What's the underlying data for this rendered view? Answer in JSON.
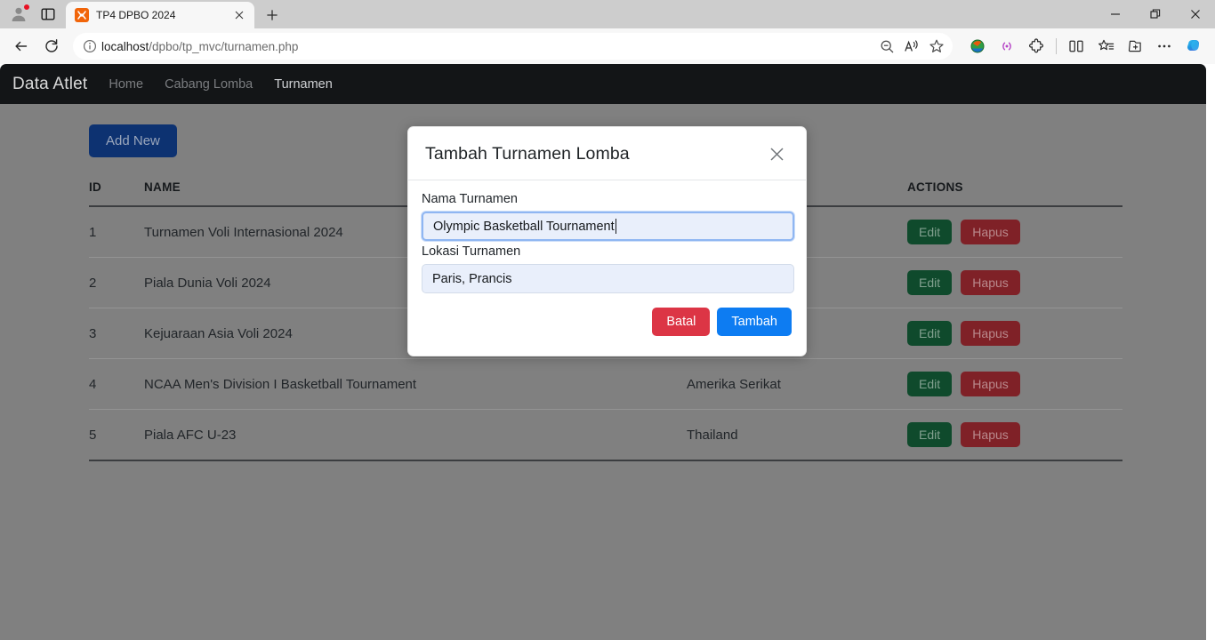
{
  "browser": {
    "tab": {
      "title": "TP4 DPBO 2024",
      "favicon": "xampp-icon",
      "close": "×"
    },
    "newtab_label": "+",
    "url": {
      "host": "localhost",
      "path": "/dpbo/tp_mvc/turnamen.php"
    },
    "window_controls": {
      "minimize": "—",
      "restore": "❐",
      "close": "✕"
    },
    "toolbar_icons": [
      "back-icon",
      "reload-icon",
      "info-icon",
      "zoom-out-icon",
      "read-aloud-icon",
      "favorite-star-icon",
      "idm-extension-icon",
      "cast-icon",
      "extensions-icon",
      "split-screen-icon",
      "collections-favorites-icon",
      "add-to-collections-icon",
      "more-settings-icon",
      "copilot-icon"
    ]
  },
  "app": {
    "brand": "Data Atlet",
    "nav": [
      {
        "label": "Home",
        "active": false
      },
      {
        "label": "Cabang Lomba",
        "active": false
      },
      {
        "label": "Turnamen",
        "active": true
      }
    ],
    "add_new_label": "Add New",
    "table": {
      "headers": [
        "ID",
        "NAME",
        "",
        "ACTIONS"
      ],
      "rows": [
        {
          "id": "1",
          "name": "Turnamen Voli Internasional 2024",
          "location": "",
          "edit": "Edit",
          "delete": "Hapus"
        },
        {
          "id": "2",
          "name": "Piala Dunia Voli 2024",
          "location": "",
          "edit": "Edit",
          "delete": "Hapus"
        },
        {
          "id": "3",
          "name": "Kejuaraan Asia Voli 2024",
          "location": "",
          "edit": "Edit",
          "delete": "Hapus"
        },
        {
          "id": "4",
          "name": "NCAA Men's Division I Basketball Tournament",
          "location": "Amerika Serikat",
          "edit": "Edit",
          "delete": "Hapus"
        },
        {
          "id": "5",
          "name": "Piala AFC U-23",
          "location": "Thailand",
          "edit": "Edit",
          "delete": "Hapus"
        }
      ]
    }
  },
  "modal": {
    "title": "Tambah Turnamen Lomba",
    "close_icon": "close-icon",
    "fields": [
      {
        "label": "Nama Turnamen",
        "value": "Olympic Basketball Tournament",
        "focused": true
      },
      {
        "label": "Lokasi Turnamen",
        "value": "Paris, Prancis",
        "focused": false
      }
    ],
    "cancel_label": "Batal",
    "submit_label": "Tambah"
  },
  "colors": {
    "navbar": "#131517",
    "backdrop": "#808080",
    "add_new": "#0d3271",
    "edit": "#0f4a2c",
    "delete": "#7f2127",
    "cancel": "#dc3545",
    "submit": "#0d7cf2",
    "input_fill": "#e9effb",
    "focus_border": "#8fb6f2"
  }
}
